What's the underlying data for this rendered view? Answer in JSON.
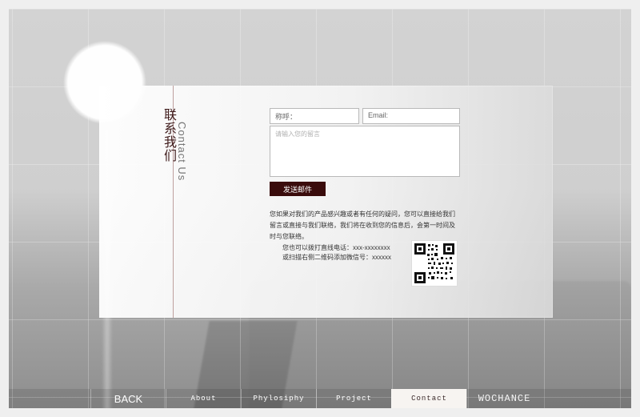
{
  "contact": {
    "title_cn": "联系我们",
    "title_en": "Contact Us"
  },
  "form": {
    "name_placeholder": "称呼：",
    "email_placeholder": "Email:",
    "message_placeholder": "请输入您的留言",
    "send_label": "发送邮件"
  },
  "info": {
    "paragraph": "您如果对我们的产品感兴趣或者有任何的疑问，您可以直接给我们留言或直接与我们联络，我们将在收到您的信息后，会第一时间及时与您联络。",
    "phone": "您也可以拨打直线电话：xxx-xxxxxxxx",
    "wechat": "或扫描右侧二维码添加微信号：xxxxxx"
  },
  "nav": {
    "items": [
      {
        "key": "back",
        "label": "BACK"
      },
      {
        "key": "about",
        "label": "About"
      },
      {
        "key": "philosophy",
        "label": "Phylosiphy"
      },
      {
        "key": "project",
        "label": "Project"
      },
      {
        "key": "contact",
        "label": "Contact"
      },
      {
        "key": "wochance",
        "label": "WOCHANCE"
      }
    ]
  },
  "colors": {
    "accent": "#3a0c0c",
    "active_tab_bg": "#f7f4f1"
  },
  "icons": {
    "qr": "qr-code-icon"
  }
}
